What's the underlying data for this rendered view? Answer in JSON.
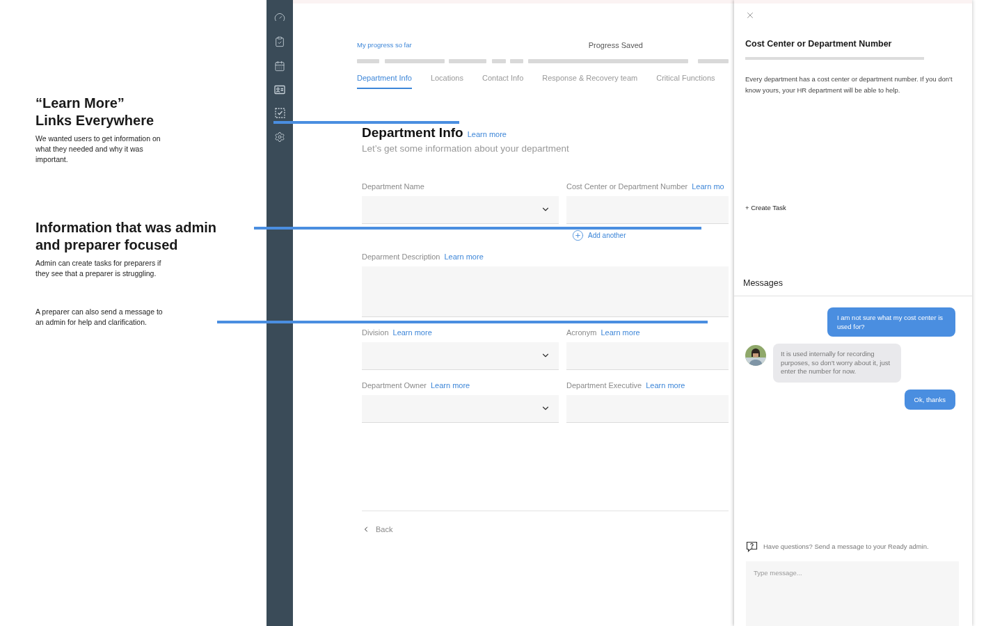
{
  "annotations": [
    {
      "title_lines": [
        "“Learn More”",
        "Links Everywhere"
      ],
      "text": "We wanted users to get information on what they needed and why it was important."
    },
    {
      "title_lines": [
        "Information that was admin",
        "and preparer focused"
      ],
      "text": "Admin can create tasks for preparers if they see that a preparer is struggling."
    },
    {
      "text": "A preparer can also send a message to an admin for help and clarification."
    }
  ],
  "progress": {
    "label": "My progress so far",
    "status": "Progress Saved"
  },
  "tabs": [
    {
      "label": "Department Info",
      "selected": true
    },
    {
      "label": "Locations",
      "selected": false
    },
    {
      "label": "Contact Info",
      "selected": false
    },
    {
      "label": "Response & Recovery team",
      "selected": false
    },
    {
      "label": "Critical Functions",
      "selected": false
    }
  ],
  "section": {
    "title": "Department Info",
    "learn_more": "Learn more",
    "subtitle": "Let’s get some information about your department"
  },
  "form_rows": [
    {
      "fields": [
        {
          "label": "Department Name",
          "kind": "select"
        },
        {
          "label": "Cost Center or Department Number",
          "learn_more": "Learn mo",
          "kind": "text",
          "add_another": "Add another"
        }
      ]
    },
    {
      "fields": [
        {
          "label": "Deparment Description",
          "learn_more": "Learn more",
          "kind": "textarea"
        }
      ]
    },
    {
      "fields": [
        {
          "label": "Division",
          "learn_more": "Learn more",
          "kind": "select"
        },
        {
          "label": "Acronym",
          "learn_more": "Learn more",
          "kind": "text"
        }
      ]
    },
    {
      "fields": [
        {
          "label": "Department Owner",
          "learn_more": "Learn more",
          "kind": "select"
        },
        {
          "label": "Department Executive",
          "learn_more": "Learn more",
          "kind": "text"
        }
      ]
    }
  ],
  "back": "Back",
  "panel": {
    "title": "Cost Center or Department Number",
    "text": "Every department has a cost center or department number. If you don't know yours, your HR department will be able to help.",
    "create_task": "+ Create Task",
    "messages_title": "Messages",
    "messages": [
      {
        "kind": "sent",
        "text": "I am not sure what my cost center is used for?"
      },
      {
        "kind": "received",
        "text": "It is used internally for recording purposes, so don't worry about it, just enter the number for now."
      },
      {
        "kind": "sent",
        "text": "Ok, thanks"
      }
    ],
    "help": "Have questions? Send a message to your Ready admin.",
    "message_field": {
      "placeholder": "Type message..."
    }
  }
}
